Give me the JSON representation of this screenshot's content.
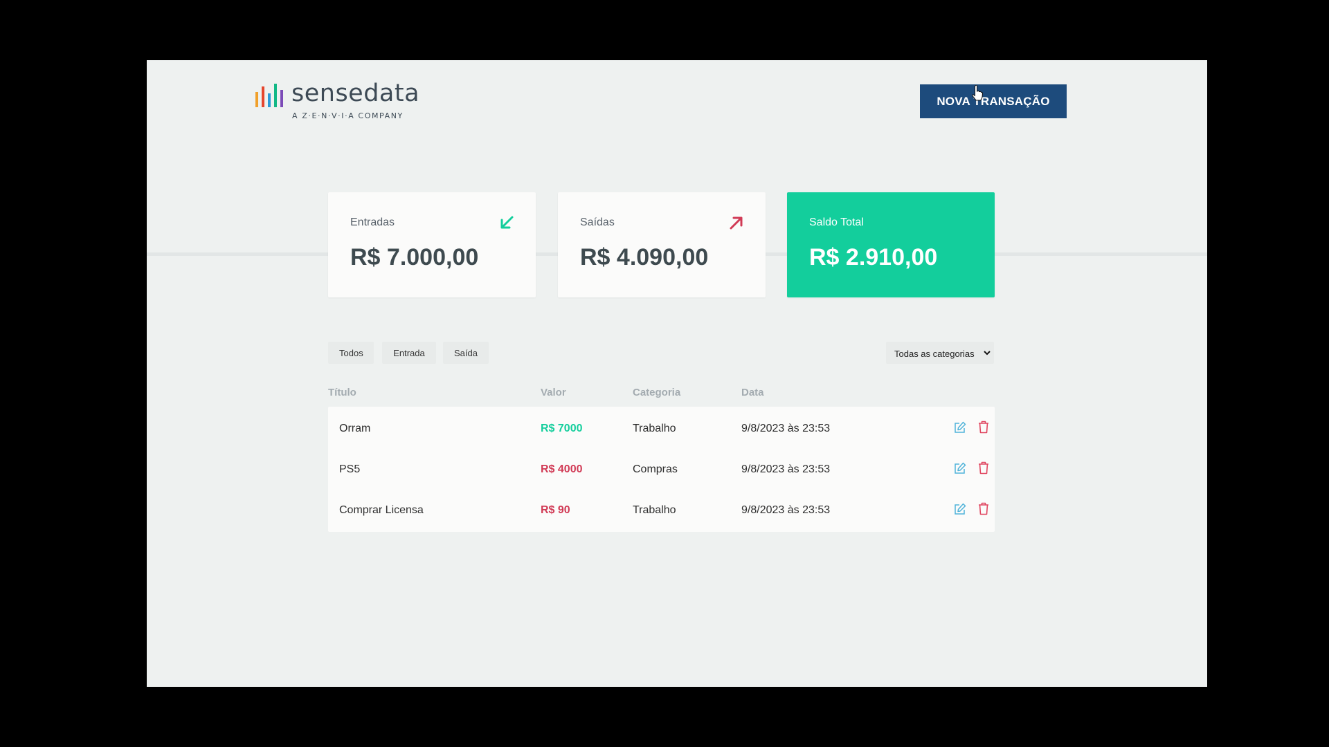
{
  "brand": {
    "name": "sensedata",
    "tagline": "A Z·E·N·V·I·A COMPANY",
    "bar_colors": [
      "#f0a02b",
      "#e5462e",
      "#2b9ad8",
      "#12b886",
      "#7b4bb7"
    ]
  },
  "header": {
    "new_transaction_label": "NOVA TRANSAÇÃO"
  },
  "summary": {
    "income": {
      "label": "Entradas",
      "value": "R$ 7.000,00",
      "icon": "arrow-down-left-icon"
    },
    "expense": {
      "label": "Saídas",
      "value": "R$ 4.090,00",
      "icon": "arrow-up-right-icon"
    },
    "total": {
      "label": "Saldo Total",
      "value": "R$ 2.910,00"
    }
  },
  "filters": {
    "all": "Todos",
    "income": "Entrada",
    "expense": "Saída",
    "category_selected": "Todas as categorias"
  },
  "table": {
    "columns": [
      "Título",
      "Valor",
      "Categoria",
      "Data"
    ],
    "rows": [
      {
        "title": "Orram",
        "value": "R$ 7000",
        "type": "income",
        "category": "Trabalho",
        "date": "9/8/2023 às 23:53"
      },
      {
        "title": "PS5",
        "value": "R$ 4000",
        "type": "expense",
        "category": "Compras",
        "date": "9/8/2023 às 23:53"
      },
      {
        "title": "Comprar Licensa",
        "value": "R$ 90",
        "type": "expense",
        "category": "Trabalho",
        "date": "9/8/2023 às 23:53"
      }
    ]
  },
  "colors": {
    "accent_green": "#13ce9c",
    "accent_red": "#d13a55",
    "primary_blue": "#1d4b7c"
  }
}
